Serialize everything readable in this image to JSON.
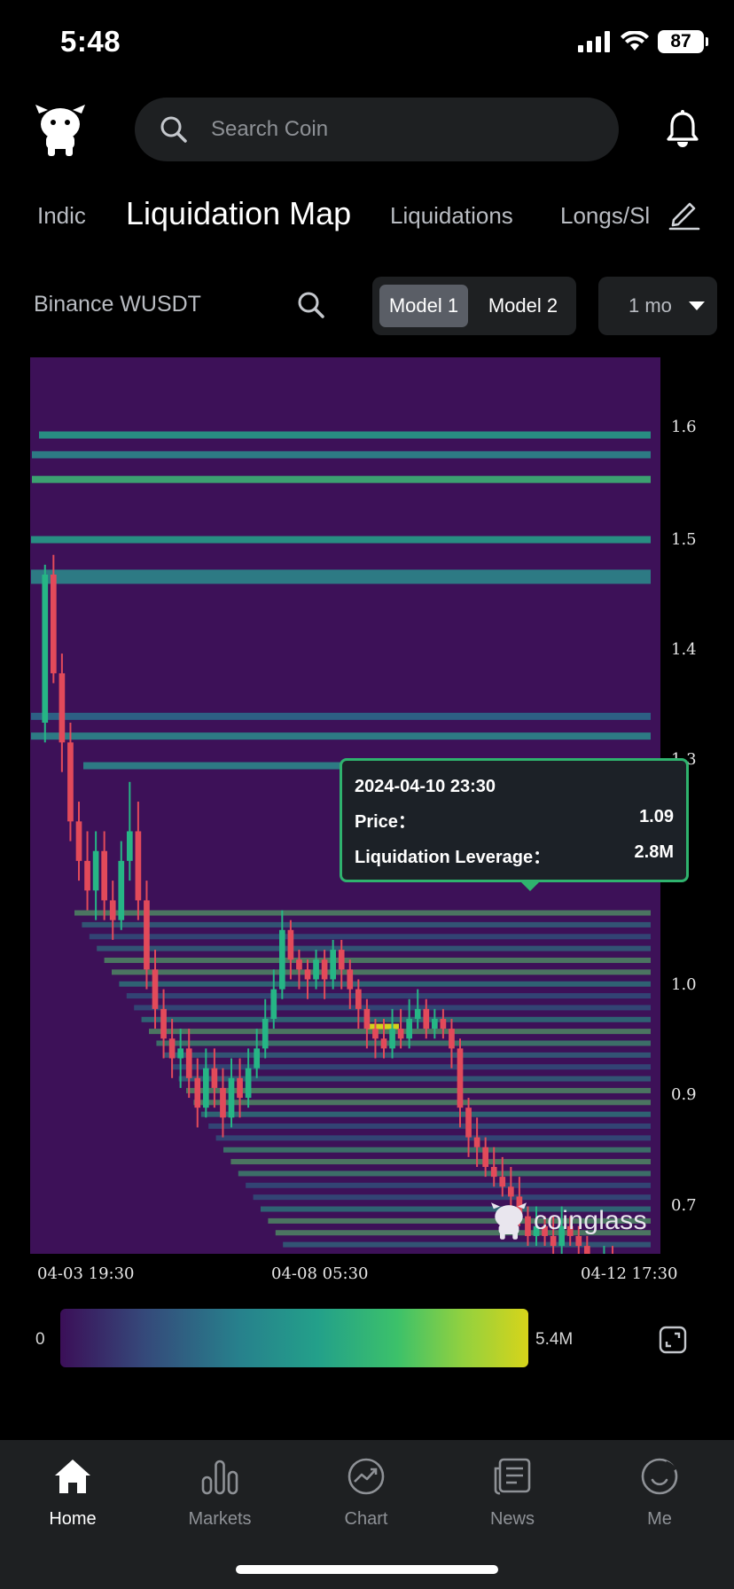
{
  "status_bar": {
    "time": "5:48",
    "battery": "87"
  },
  "header": {
    "search_placeholder": "Search Coin"
  },
  "tabs": [
    {
      "label": "Indic"
    },
    {
      "label": "Liquidation Map"
    },
    {
      "label": "Liquidations"
    },
    {
      "label": "Longs/Sl"
    }
  ],
  "controls": {
    "pair": "Binance WUSDT",
    "model1": "Model 1",
    "model2": "Model 2",
    "period": "1 mo"
  },
  "chart_data": {
    "type": "heatmap",
    "x_ticks": [
      "04-03 19:30",
      "04-08 05:30",
      "04-12 17:30"
    ],
    "y_ticks": [
      "1.6",
      "1.5",
      "1.4",
      "1.3",
      "1.0",
      "0.9",
      "0.7"
    ],
    "colorscale": {
      "min": "0",
      "max": "5.4M"
    },
    "candles": [
      [
        1.3,
        1.45,
        1.28,
        1.46
      ],
      [
        1.45,
        1.35,
        1.34,
        1.47
      ],
      [
        1.35,
        1.28,
        1.25,
        1.37
      ],
      [
        1.28,
        1.2,
        1.18,
        1.3
      ],
      [
        1.2,
        1.16,
        1.14,
        1.22
      ],
      [
        1.16,
        1.13,
        1.11,
        1.19
      ],
      [
        1.13,
        1.17,
        1.1,
        1.19
      ],
      [
        1.17,
        1.12,
        1.1,
        1.19
      ],
      [
        1.12,
        1.1,
        1.08,
        1.14
      ],
      [
        1.1,
        1.16,
        1.09,
        1.18
      ],
      [
        1.16,
        1.19,
        1.14,
        1.24
      ],
      [
        1.19,
        1.12,
        1.1,
        1.22
      ],
      [
        1.12,
        1.05,
        1.03,
        1.14
      ],
      [
        1.05,
        1.01,
        0.99,
        1.07
      ],
      [
        1.01,
        0.98,
        0.96,
        1.03
      ],
      [
        0.98,
        0.96,
        0.94,
        1.0
      ],
      [
        0.96,
        0.97,
        0.93,
        0.99
      ],
      [
        0.97,
        0.94,
        0.92,
        0.99
      ],
      [
        0.94,
        0.91,
        0.89,
        0.96
      ],
      [
        0.91,
        0.95,
        0.9,
        0.97
      ],
      [
        0.95,
        0.93,
        0.91,
        0.97
      ],
      [
        0.93,
        0.9,
        0.88,
        0.95
      ],
      [
        0.9,
        0.94,
        0.89,
        0.96
      ],
      [
        0.94,
        0.92,
        0.9,
        0.96
      ],
      [
        0.92,
        0.95,
        0.91,
        0.97
      ],
      [
        0.95,
        0.97,
        0.94,
        0.99
      ],
      [
        0.97,
        1.0,
        0.96,
        1.02
      ],
      [
        1.0,
        1.03,
        0.99,
        1.05
      ],
      [
        1.03,
        1.09,
        1.02,
        1.11
      ],
      [
        1.09,
        1.06,
        1.04,
        1.1
      ],
      [
        1.06,
        1.05,
        1.03,
        1.07
      ],
      [
        1.05,
        1.04,
        1.02,
        1.06
      ],
      [
        1.04,
        1.06,
        1.03,
        1.07
      ],
      [
        1.06,
        1.04,
        1.02,
        1.07
      ],
      [
        1.04,
        1.07,
        1.03,
        1.08
      ],
      [
        1.07,
        1.05,
        1.03,
        1.08
      ],
      [
        1.05,
        1.03,
        1.01,
        1.06
      ],
      [
        1.03,
        1.01,
        0.99,
        1.04
      ],
      [
        1.01,
        0.99,
        0.97,
        1.02
      ],
      [
        0.99,
        0.98,
        0.96,
        1.0
      ],
      [
        0.98,
        0.97,
        0.96,
        1.0
      ],
      [
        0.97,
        0.99,
        0.96,
        1.01
      ],
      [
        0.99,
        0.98,
        0.97,
        1.01
      ],
      [
        0.98,
        1.0,
        0.97,
        1.02
      ],
      [
        1.0,
        1.01,
        0.99,
        1.03
      ],
      [
        1.01,
        0.99,
        0.98,
        1.02
      ],
      [
        0.99,
        1.0,
        0.98,
        1.01
      ],
      [
        1.0,
        0.99,
        0.98,
        1.01
      ],
      [
        0.99,
        0.97,
        0.95,
        1.0
      ],
      [
        0.97,
        0.91,
        0.89,
        0.98
      ],
      [
        0.91,
        0.88,
        0.86,
        0.92
      ],
      [
        0.88,
        0.87,
        0.85,
        0.9
      ],
      [
        0.87,
        0.85,
        0.84,
        0.88
      ],
      [
        0.85,
        0.84,
        0.83,
        0.87
      ],
      [
        0.84,
        0.83,
        0.82,
        0.86
      ],
      [
        0.83,
        0.82,
        0.81,
        0.85
      ],
      [
        0.82,
        0.8,
        0.79,
        0.84
      ],
      [
        0.8,
        0.78,
        0.77,
        0.81
      ],
      [
        0.78,
        0.79,
        0.77,
        0.81
      ],
      [
        0.79,
        0.78,
        0.77,
        0.8
      ],
      [
        0.78,
        0.77,
        0.76,
        0.8
      ],
      [
        0.77,
        0.79,
        0.76,
        0.81
      ],
      [
        0.79,
        0.78,
        0.77,
        0.8
      ],
      [
        0.78,
        0.77,
        0.75,
        0.79
      ],
      [
        0.77,
        0.75,
        0.74,
        0.78
      ],
      [
        0.75,
        0.74,
        0.73,
        0.76
      ],
      [
        0.74,
        0.76,
        0.73,
        0.77
      ],
      [
        0.76,
        0.74,
        0.73,
        0.77
      ],
      [
        0.74,
        0.73,
        0.72,
        0.75
      ],
      [
        0.73,
        0.75,
        0.72,
        0.76
      ],
      [
        0.75,
        0.74,
        0.73,
        0.76
      ],
      [
        0.74,
        0.72,
        0.71,
        0.75
      ]
    ],
    "tooltip": {
      "time": "2024-04-10 23:30",
      "price_label": "Price：",
      "price": "1.09",
      "leverage_label": "Liquidation Leverage：",
      "leverage": "2.8M"
    },
    "watermark": "coinglass"
  },
  "nav": [
    {
      "label": "Home",
      "icon": "home-icon"
    },
    {
      "label": "Markets",
      "icon": "markets-icon"
    },
    {
      "label": "Chart",
      "icon": "chart-icon"
    },
    {
      "label": "News",
      "icon": "news-icon"
    },
    {
      "label": "Me",
      "icon": "me-icon"
    }
  ],
  "colors": {
    "up": "#26b585",
    "down": "#e24a5a",
    "chart_bg": "#3d1158",
    "tooltip_border": "#2fb36e"
  }
}
